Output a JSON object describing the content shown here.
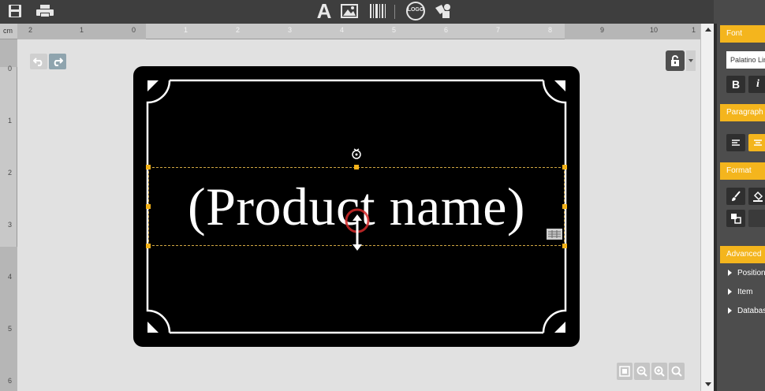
{
  "toolbar": {
    "left_icons": [
      "save-icon",
      "print-icon"
    ],
    "center_icons": [
      "text-tool-icon",
      "image-tool-icon",
      "barcode-tool-icon",
      "logo-tool-icon",
      "shape-tool-icon"
    ],
    "logo_label": "LOGO",
    "text_tool_label": "A"
  },
  "ruler": {
    "unit": "cm",
    "top_numbers": [
      "2",
      "1",
      "0",
      "1",
      "2",
      "3",
      "4",
      "5",
      "6",
      "7",
      "8",
      "9",
      "10",
      "1"
    ],
    "left_numbers": [
      "0",
      "1",
      "2",
      "3",
      "4",
      "5",
      "6"
    ]
  },
  "canvas": {
    "background": "#e1e1e1",
    "label": {
      "text": "(Product name)",
      "background": "#000000",
      "text_color": "#ffffff"
    },
    "selection_color": "#f3b21a"
  },
  "panel": {
    "accent": "#f4b51d",
    "font_header": "Font",
    "font_name": "Palatino Linotype",
    "bold_label": "B",
    "italic_label": "i",
    "paragraph_header": "Paragraph",
    "format_header": "Format",
    "advanced_header": "Advanced",
    "advanced_items": [
      "Position",
      "Item",
      "Database"
    ]
  }
}
